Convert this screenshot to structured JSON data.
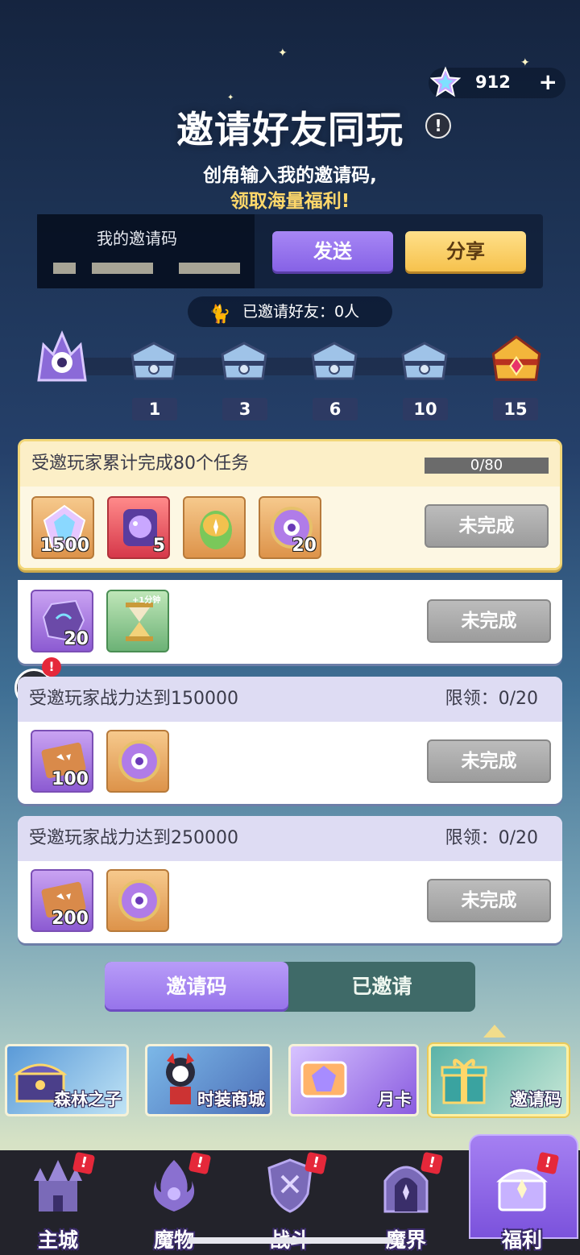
{
  "currency": {
    "value": "912",
    "icon": "star-gem-icon",
    "plus": "+"
  },
  "header": {
    "title": "邀请好友同玩",
    "help": "!",
    "subtitle_line1": "创角输入我的邀请码,",
    "subtitle_line2": "领取海量福利!"
  },
  "code_panel": {
    "label": "我的邀请码",
    "send_label": "发送",
    "share_label": "分享"
  },
  "invited_count": "已邀请好友：0人",
  "milestones": [
    "1",
    "3",
    "6",
    "10",
    "15"
  ],
  "tasks": [
    {
      "title": "受邀玩家累计完成80个任务",
      "progress": "0/80",
      "rewards": [
        {
          "icon": "crystal-gem-icon",
          "count": "1500"
        },
        {
          "icon": "galaxy-scroll-icon",
          "count": "5"
        },
        {
          "icon": "rainbow-egg-icon",
          "count": ""
        },
        {
          "icon": "purple-emblem-icon",
          "count": "20"
        }
      ],
      "rewards_extra": [
        {
          "icon": "purple-ore-icon",
          "count": "20"
        },
        {
          "icon": "hourglass-icon",
          "count": "",
          "tag": "+1分钟"
        }
      ],
      "status": "未完成"
    },
    {
      "title": "受邀玩家战力达到150000",
      "limit": "限领：0/20",
      "rewards": [
        {
          "icon": "map-scroll-icon",
          "count": "100"
        },
        {
          "icon": "purple-emblem-icon",
          "count": ""
        }
      ],
      "status": "未完成"
    },
    {
      "title": "受邀玩家战力达到250000",
      "limit": "限领：0/20",
      "rewards": [
        {
          "icon": "map-scroll-icon",
          "count": "200"
        },
        {
          "icon": "purple-emblem-icon",
          "count": ""
        }
      ],
      "status": "未完成"
    }
  ],
  "chat_badge": "!",
  "tabs": {
    "code": "邀请码",
    "invited": "已邀请"
  },
  "promos": [
    {
      "label": "森林之子",
      "icon": "treasure-chest-icon"
    },
    {
      "label": "时装商城",
      "icon": "costume-character-icon"
    },
    {
      "label": "月卡",
      "icon": "crystal-card-icon"
    },
    {
      "label": "邀请码",
      "icon": "gift-box-icon"
    }
  ],
  "nav": [
    {
      "label": "主城",
      "icon": "castle-icon",
      "badge": "!"
    },
    {
      "label": "魔物",
      "icon": "flame-monster-icon",
      "badge": "!"
    },
    {
      "label": "战斗",
      "icon": "shield-icon",
      "badge": "!"
    },
    {
      "label": "魔界",
      "icon": "portal-gate-icon",
      "badge": "!"
    },
    {
      "label": "福利",
      "icon": "reward-chest-icon",
      "badge": "!"
    }
  ],
  "colors": {
    "accent_purple": "#9572ea",
    "gold": "#f6c24d",
    "alert_red": "#e5283a"
  }
}
